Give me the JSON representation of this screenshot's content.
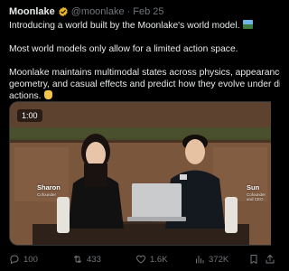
{
  "author": {
    "name": "Moonlake",
    "handle": "@moonlake",
    "separator": "·",
    "date": "Feb 25"
  },
  "post": {
    "line1": "Introducing a world built by the Moonlake's world model.",
    "line2": "Most world models only allow for a limited action space.",
    "line3": "Moonlake maintains multimodal states across physics, appearance,",
    "line4": "geometry, and casual effects and predict how they evolve under different",
    "line5": "actions."
  },
  "media": {
    "timer": "1:00",
    "left_name": "Sharon",
    "left_title": "Cofounder",
    "right_name": "Sun",
    "right_title": "Cofounder and CEO"
  },
  "actions": {
    "replies": "100",
    "reposts": "433",
    "likes": "1.6K",
    "views": "372K"
  },
  "colors": {
    "background": "#000000",
    "text": "#e7e9ea",
    "muted": "#71767b",
    "verified": "#e8b524"
  }
}
